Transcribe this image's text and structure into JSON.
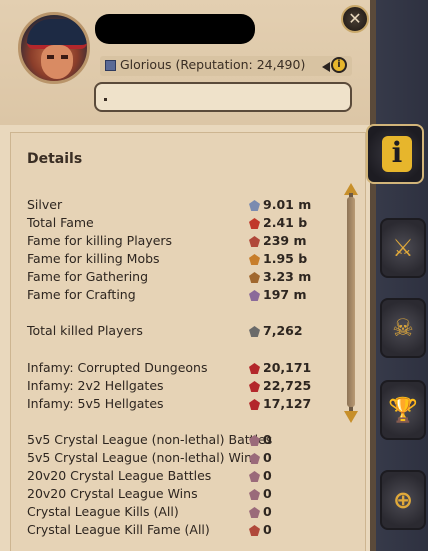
{
  "header": {
    "close_label": "✕",
    "reputation": "Glorious (Reputation: 24,490)",
    "info_label": "i"
  },
  "details": {
    "title": "Details",
    "rows": [
      {
        "label": "Silver",
        "value": "9.01 m",
        "icon": "silver-icon"
      },
      {
        "label": "Total Fame",
        "value": "2.41 b",
        "icon": "fame-icon"
      },
      {
        "label": "Fame for killing Players",
        "value": "239 m",
        "icon": "pvp-fame-icon"
      },
      {
        "label": "Fame for killing Mobs",
        "value": "1.95 b",
        "icon": "pve-fame-icon"
      },
      {
        "label": "Fame for Gathering",
        "value": "3.23 m",
        "icon": "gathering-fame-icon"
      },
      {
        "label": "Fame for Crafting",
        "value": "197 m",
        "icon": "crafting-fame-icon"
      },
      {
        "label": "Total killed Players",
        "value": "7,262",
        "icon": "crossed-swords-icon"
      },
      {
        "label": "Infamy: Corrupted Dungeons",
        "value": "20,171",
        "icon": "infamy-icon"
      },
      {
        "label": "Infamy: 2v2 Hellgates",
        "value": "22,725",
        "icon": "infamy-icon"
      },
      {
        "label": "Infamy: 5v5 Hellgates",
        "value": "17,127",
        "icon": "infamy-icon"
      },
      {
        "label": "5v5 Crystal League (non-lethal) Battles",
        "value": "0",
        "icon": "crystal-shield-icon"
      },
      {
        "label": "5v5 Crystal League (non-lethal) Wins",
        "value": "0",
        "icon": "crystal-shield-icon"
      },
      {
        "label": "20v20 Crystal League Battles",
        "value": "0",
        "icon": "crystal-shield-icon"
      },
      {
        "label": "20v20 Crystal League Wins",
        "value": "0",
        "icon": "crystal-shield-icon"
      },
      {
        "label": "Crystal League Kills (All)",
        "value": "0",
        "icon": "crystal-shield-icon"
      },
      {
        "label": "Crystal League Kill Fame (All)",
        "value": "0",
        "icon": "crystal-fame-icon"
      }
    ]
  },
  "sidebar": {
    "tabs": [
      {
        "name": "info-tab",
        "glyph": "i",
        "active": true
      },
      {
        "name": "combat-tab",
        "glyph": "⚔",
        "active": false
      },
      {
        "name": "pvp-tab",
        "glyph": "☠",
        "active": false
      },
      {
        "name": "achievements-tab",
        "glyph": "🏆",
        "active": false
      },
      {
        "name": "guild-tab",
        "glyph": "⊕",
        "active": false
      }
    ]
  },
  "colors": {
    "panel": "#e9d8bd",
    "accent_gold": "#e7b62c",
    "text": "#2e2620",
    "infamy_red": "#b3272b",
    "fame_red": "#c0392b",
    "silver_blue": "#7a8bb0"
  }
}
